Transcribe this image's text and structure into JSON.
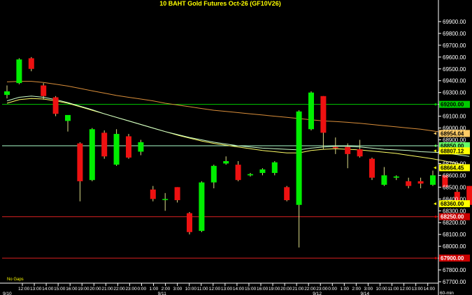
{
  "chart_data": {
    "type": "candlestick",
    "title": "10 BAHT Gold Futures Oct-26 (GF10V26)",
    "bottom_left_label": "No Gaps",
    "bottom_right_label": "60-min",
    "ylim": [
      67700,
      70000
    ],
    "y_ticks": [
      67700,
      67800,
      67900,
      68000,
      68100,
      68200,
      68300,
      68400,
      68500,
      68600,
      68700,
      68800,
      68900,
      69000,
      69100,
      69200,
      69300,
      69400,
      69500,
      69600,
      69700,
      69800,
      69900
    ],
    "y_tick_labels": [
      "67700.00",
      "67800.00",
      "67900.00",
      "68000.00",
      "68100.00",
      "68200.00",
      "68300.00",
      "68400.00",
      "68500.00",
      "68600.00",
      "68700.00",
      "68800.00",
      "68900.00",
      "69000.00",
      "69100.00",
      "69200.00",
      "69300.00",
      "69400.00",
      "69500.00",
      "69600.00",
      "69700.00",
      "69800.00",
      "69900.00"
    ],
    "x_labels": [
      "12:00",
      "13:00",
      "14:00",
      "15:00",
      "16:00",
      "19:00",
      "20:00",
      "21:00",
      "22:00",
      "23:00",
      "0:00",
      "1:00",
      "2:00",
      "3:00",
      "10:00",
      "11:00",
      "12:00",
      "13:00",
      "14:00",
      "15:00",
      "16:00",
      "19:00",
      "20:00",
      "21:00",
      "22:00",
      "23:00",
      "0:00",
      "1:00",
      "2:00",
      "3:00",
      "10:00",
      "11:00",
      "12:00",
      "13:00",
      "14:00"
    ],
    "date_labels": [
      {
        "label": "9/10",
        "index": 0
      },
      {
        "label": "9/11",
        "index": 13
      },
      {
        "label": "9/12",
        "index": 26
      },
      {
        "label": "9/14",
        "index": 30
      }
    ],
    "candles": [
      {
        "o": 69280,
        "h": 69360,
        "l": 69250,
        "c": 69310
      },
      {
        "o": 69380,
        "h": 69590,
        "l": 69370,
        "c": 69580
      },
      {
        "o": 69590,
        "h": 69600,
        "l": 69480,
        "c": 69500
      },
      {
        "o": 69360,
        "h": 69380,
        "l": 69240,
        "c": 69270
      },
      {
        "o": 69260,
        "h": 69270,
        "l": 69100,
        "c": 69120
      },
      {
        "o": 69060,
        "h": 69100,
        "l": 68970,
        "c": 69110
      },
      {
        "o": 68870,
        "h": 68880,
        "l": 68380,
        "c": 68550
      },
      {
        "o": 68560,
        "h": 69000,
        "l": 68550,
        "c": 68990
      },
      {
        "o": 68960,
        "h": 68980,
        "l": 68740,
        "c": 68760
      },
      {
        "o": 68690,
        "h": 68990,
        "l": 68680,
        "c": 68950
      },
      {
        "o": 68930,
        "h": 68950,
        "l": 68740,
        "c": 68750
      },
      {
        "o": 68800,
        "h": 68900,
        "l": 68770,
        "c": 68880
      },
      {
        "o": 68480,
        "h": 68510,
        "l": 68380,
        "c": 68400
      },
      {
        "o": 68400,
        "h": 68450,
        "l": 68300,
        "c": 68400
      },
      {
        "o": 68500,
        "h": 68500,
        "l": 68370,
        "c": 68390
      },
      {
        "o": 68280,
        "h": 68290,
        "l": 68100,
        "c": 68120
      },
      {
        "o": 68130,
        "h": 68550,
        "l": 68120,
        "c": 68540
      },
      {
        "o": 68540,
        "h": 68690,
        "l": 68490,
        "c": 68680
      },
      {
        "o": 68700,
        "h": 68760,
        "l": 68690,
        "c": 68720
      },
      {
        "o": 68690,
        "h": 68720,
        "l": 68550,
        "c": 68560
      },
      {
        "o": 68600,
        "h": 68620,
        "l": 68590,
        "c": 68610
      },
      {
        "o": 68620,
        "h": 68660,
        "l": 68600,
        "c": 68650
      },
      {
        "o": 68620,
        "h": 68720,
        "l": 68600,
        "c": 68710
      },
      {
        "o": 68500,
        "h": 68510,
        "l": 68380,
        "c": 68390
      },
      {
        "o": 68350,
        "h": 69150,
        "l": 67990,
        "c": 69140
      },
      {
        "o": 68990,
        "h": 69310,
        "l": 68980,
        "c": 69300
      },
      {
        "o": 69270,
        "h": 69270,
        "l": 68820,
        "c": 68960
      },
      {
        "o": 68840,
        "h": 68920,
        "l": 68780,
        "c": 68830
      },
      {
        "o": 68840,
        "h": 68870,
        "l": 68660,
        "c": 68780
      },
      {
        "o": 68820,
        "h": 68900,
        "l": 68750,
        "c": 68760
      },
      {
        "o": 68740,
        "h": 68750,
        "l": 68560,
        "c": 68580
      },
      {
        "o": 68520,
        "h": 68670,
        "l": 68510,
        "c": 68600
      },
      {
        "o": 68580,
        "h": 68600,
        "l": 68560,
        "c": 68590
      },
      {
        "o": 68550,
        "h": 68580,
        "l": 68490,
        "c": 68510
      },
      {
        "o": 68550,
        "h": 68580,
        "l": 68490,
        "c": 68530
      },
      {
        "o": 68520,
        "h": 68640,
        "l": 68510,
        "c": 68600
      },
      {
        "o": 68600,
        "h": 68600,
        "l": 68500,
        "c": 68500
      },
      {
        "o": 68460,
        "h": 68480,
        "l": 68360,
        "c": 68360
      },
      {
        "o": 68510,
        "h": 68510,
        "l": 68350,
        "c": 68350
      }
    ],
    "moving_averages": [
      {
        "color": "#d98e3a",
        "values": [
          69390,
          69395,
          69395,
          69385,
          69370,
          69355,
          69335,
          69315,
          69295,
          69275,
          69260,
          69245,
          69230,
          69210,
          69195,
          69180,
          69165,
          69150,
          69140,
          69130,
          69120,
          69110,
          69100,
          69090,
          69080,
          69070,
          69060,
          69055,
          69048,
          69040,
          69030,
          69020,
          69010,
          69000,
          68990,
          68975,
          68960,
          68945,
          68930
        ]
      },
      {
        "color": "#ffff66",
        "values": [
          69210,
          69240,
          69250,
          69245,
          69230,
          69210,
          69180,
          69150,
          69120,
          69090,
          69060,
          69030,
          69000,
          68970,
          68940,
          68915,
          68890,
          68870,
          68855,
          68840,
          68825,
          68810,
          68800,
          68790,
          68790,
          68810,
          68820,
          68825,
          68820,
          68815,
          68805,
          68795,
          68785,
          68770,
          68755,
          68740,
          68720,
          68700,
          68680
        ]
      },
      {
        "color": "#ccffcc",
        "values": [
          69230,
          69260,
          69270,
          69260,
          69240,
          69215,
          69185,
          69155,
          69120,
          69090,
          69060,
          69030,
          69000,
          68970,
          68945,
          68920,
          68900,
          68880,
          68865,
          68850,
          68840,
          68830,
          68825,
          68820,
          68815,
          68830,
          68840,
          68845,
          68845,
          68840,
          68830,
          68820,
          68815,
          68810,
          68800,
          68795,
          68790,
          68775,
          68760
        ]
      }
    ],
    "horizontal_lines": [
      {
        "value": 69200,
        "label": "69200.00",
        "line_color": "#00cc00",
        "tag_bg": "#00cc00",
        "tag_fg": "#000000"
      },
      {
        "value": 68850,
        "label": "68850.00",
        "line_color": "#aaffcc",
        "tag_bg": "#66ff66",
        "tag_fg": "#000000"
      },
      {
        "value": 68250,
        "label": "68250.00",
        "line_color": "#dd2222",
        "tag_bg": "#cc0000",
        "tag_fg": "#ffffff"
      },
      {
        "value": 67900,
        "label": "67900.00",
        "line_color": "#dd2222",
        "tag_bg": "#cc0000",
        "tag_fg": "#ffffff"
      }
    ],
    "price_tags": [
      {
        "value": 68954.04,
        "label": "68954.04",
        "bg": "#ffcc66",
        "fg": "#000000"
      },
      {
        "value": 68807.12,
        "label": "68807.12",
        "bg": "#ffff00",
        "fg": "#000000"
      },
      {
        "value": 68664.45,
        "label": "68664.45",
        "bg": "#ffff00",
        "fg": "#000000"
      },
      {
        "value": 68360,
        "label": "68360.00",
        "bg": "#ffff00",
        "fg": "#000000"
      }
    ],
    "up_color": "#00ee00",
    "down_color": "#ee1111",
    "background": "#000000",
    "grid": false
  }
}
